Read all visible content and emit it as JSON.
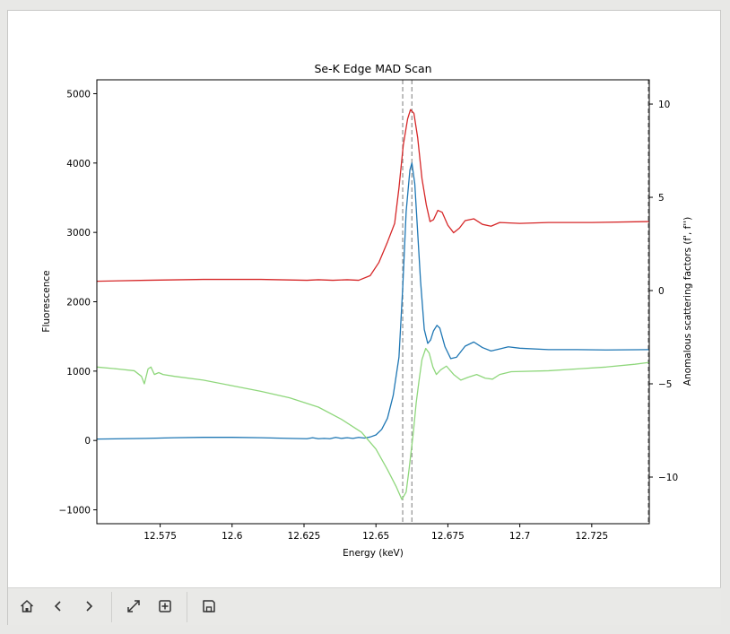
{
  "chart_data": {
    "type": "line",
    "title": "Se-K Edge MAD Scan",
    "xlabel": "Energy (keV)",
    "ylabel_left": "Fluorescence",
    "ylabel_right": "Anomalous scattering factors (f', f'')",
    "xlim": [
      12.553,
      12.745
    ],
    "ylim_left": [
      -1200,
      5200
    ],
    "ylim_right": [
      -12.5,
      11.3
    ],
    "x_ticks": [
      {
        "value": 12.575,
        "label": "12.575"
      },
      {
        "value": 12.6,
        "label": "12.6"
      },
      {
        "value": 12.625,
        "label": "12.625"
      },
      {
        "value": 12.65,
        "label": "12.65"
      },
      {
        "value": 12.675,
        "label": "12.675"
      },
      {
        "value": 12.7,
        "label": "12.7"
      },
      {
        "value": 12.725,
        "label": "12.725"
      }
    ],
    "y_ticks_left": [
      {
        "value": 5000,
        "label": "5000"
      },
      {
        "value": 4000,
        "label": "4000"
      },
      {
        "value": 3000,
        "label": "3000"
      },
      {
        "value": 2000,
        "label": "2000"
      },
      {
        "value": 1000,
        "label": "1000"
      },
      {
        "value": 0,
        "label": "0"
      },
      {
        "value": -1000,
        "label": "−1000"
      }
    ],
    "y_ticks_right": [
      {
        "value": 10,
        "label": "10"
      },
      {
        "value": 5,
        "label": "5"
      },
      {
        "value": 0,
        "label": "0"
      },
      {
        "value": -5,
        "label": "−5"
      },
      {
        "value": -10,
        "label": "−10"
      }
    ],
    "vlines": [
      12.6593,
      12.6625
    ],
    "vline_right_edge": 12.745,
    "series": [
      {
        "axis": "left",
        "color": "#1f77b4",
        "points": [
          [
            12.553,
            20
          ],
          [
            12.57,
            30
          ],
          [
            12.58,
            40
          ],
          [
            12.59,
            45
          ],
          [
            12.6,
            45
          ],
          [
            12.61,
            40
          ],
          [
            12.62,
            30
          ],
          [
            12.626,
            25
          ],
          [
            12.628,
            40
          ],
          [
            12.63,
            25
          ],
          [
            12.632,
            30
          ],
          [
            12.634,
            25
          ],
          [
            12.636,
            45
          ],
          [
            12.638,
            30
          ],
          [
            12.64,
            40
          ],
          [
            12.642,
            30
          ],
          [
            12.644,
            45
          ],
          [
            12.646,
            35
          ],
          [
            12.648,
            50
          ],
          [
            12.65,
            80
          ],
          [
            12.652,
            160
          ],
          [
            12.654,
            320
          ],
          [
            12.656,
            650
          ],
          [
            12.658,
            1200
          ],
          [
            12.6593,
            2200
          ],
          [
            12.6605,
            3300
          ],
          [
            12.6618,
            3900
          ],
          [
            12.6625,
            4000
          ],
          [
            12.6635,
            3700
          ],
          [
            12.6645,
            3000
          ],
          [
            12.6655,
            2300
          ],
          [
            12.6668,
            1600
          ],
          [
            12.668,
            1400
          ],
          [
            12.669,
            1450
          ],
          [
            12.67,
            1580
          ],
          [
            12.6712,
            1660
          ],
          [
            12.6722,
            1620
          ],
          [
            12.674,
            1350
          ],
          [
            12.676,
            1180
          ],
          [
            12.678,
            1200
          ],
          [
            12.681,
            1360
          ],
          [
            12.684,
            1420
          ],
          [
            12.687,
            1340
          ],
          [
            12.69,
            1290
          ],
          [
            12.693,
            1320
          ],
          [
            12.696,
            1350
          ],
          [
            12.7,
            1330
          ],
          [
            12.71,
            1310
          ],
          [
            12.72,
            1310
          ],
          [
            12.73,
            1305
          ],
          [
            12.745,
            1310
          ]
        ]
      },
      {
        "axis": "right",
        "color": "#d62728",
        "points": [
          [
            12.553,
            0.5
          ],
          [
            12.57,
            0.55
          ],
          [
            12.59,
            0.6
          ],
          [
            12.61,
            0.6
          ],
          [
            12.626,
            0.55
          ],
          [
            12.63,
            0.58
          ],
          [
            12.635,
            0.55
          ],
          [
            12.64,
            0.58
          ],
          [
            12.644,
            0.55
          ],
          [
            12.648,
            0.8
          ],
          [
            12.651,
            1.5
          ],
          [
            12.654,
            2.6
          ],
          [
            12.6565,
            3.6
          ],
          [
            12.658,
            5.5
          ],
          [
            12.6595,
            7.8
          ],
          [
            12.661,
            9.2
          ],
          [
            12.662,
            9.7
          ],
          [
            12.6632,
            9.5
          ],
          [
            12.6645,
            8.2
          ],
          [
            12.666,
            6.0
          ],
          [
            12.6675,
            4.6
          ],
          [
            12.6688,
            3.7
          ],
          [
            12.67,
            3.8
          ],
          [
            12.6715,
            4.3
          ],
          [
            12.673,
            4.2
          ],
          [
            12.675,
            3.5
          ],
          [
            12.677,
            3.1
          ],
          [
            12.679,
            3.35
          ],
          [
            12.681,
            3.75
          ],
          [
            12.684,
            3.85
          ],
          [
            12.687,
            3.55
          ],
          [
            12.69,
            3.45
          ],
          [
            12.693,
            3.65
          ],
          [
            12.7,
            3.6
          ],
          [
            12.71,
            3.65
          ],
          [
            12.725,
            3.65
          ],
          [
            12.745,
            3.7
          ]
        ]
      },
      {
        "axis": "right",
        "color": "#8fd77c",
        "points": [
          [
            12.553,
            -4.1
          ],
          [
            12.56,
            -4.2
          ],
          [
            12.566,
            -4.3
          ],
          [
            12.5685,
            -4.6
          ],
          [
            12.5695,
            -5.0
          ],
          [
            12.5708,
            -4.2
          ],
          [
            12.5718,
            -4.1
          ],
          [
            12.573,
            -4.5
          ],
          [
            12.5745,
            -4.4
          ],
          [
            12.576,
            -4.5
          ],
          [
            12.58,
            -4.6
          ],
          [
            12.59,
            -4.8
          ],
          [
            12.6,
            -5.1
          ],
          [
            12.61,
            -5.4
          ],
          [
            12.62,
            -5.75
          ],
          [
            12.63,
            -6.25
          ],
          [
            12.638,
            -6.9
          ],
          [
            12.645,
            -7.6
          ],
          [
            12.65,
            -8.5
          ],
          [
            12.654,
            -9.6
          ],
          [
            12.657,
            -10.5
          ],
          [
            12.659,
            -11.2
          ],
          [
            12.6605,
            -10.8
          ],
          [
            12.6615,
            -9.6
          ],
          [
            12.663,
            -7.6
          ],
          [
            12.664,
            -6.0
          ],
          [
            12.665,
            -4.8
          ],
          [
            12.666,
            -3.7
          ],
          [
            12.6673,
            -3.1
          ],
          [
            12.6685,
            -3.35
          ],
          [
            12.6698,
            -4.1
          ],
          [
            12.671,
            -4.5
          ],
          [
            12.6725,
            -4.25
          ],
          [
            12.6745,
            -4.05
          ],
          [
            12.677,
            -4.5
          ],
          [
            12.6795,
            -4.8
          ],
          [
            12.682,
            -4.65
          ],
          [
            12.685,
            -4.5
          ],
          [
            12.688,
            -4.7
          ],
          [
            12.6905,
            -4.75
          ],
          [
            12.693,
            -4.5
          ],
          [
            12.697,
            -4.35
          ],
          [
            12.71,
            -4.3
          ],
          [
            12.72,
            -4.2
          ],
          [
            12.73,
            -4.1
          ],
          [
            12.74,
            -3.95
          ],
          [
            12.745,
            -3.85
          ]
        ]
      }
    ]
  },
  "toolbar": {
    "buttons": [
      {
        "name": "home",
        "icon": "home-icon"
      },
      {
        "name": "back",
        "icon": "chevron-left-icon"
      },
      {
        "name": "forward",
        "icon": "chevron-right-icon"
      },
      {
        "name": "pan",
        "icon": "expand-arrows-icon"
      },
      {
        "name": "zoom",
        "icon": "zoom-rect-icon"
      },
      {
        "name": "save",
        "icon": "save-icon"
      }
    ]
  }
}
